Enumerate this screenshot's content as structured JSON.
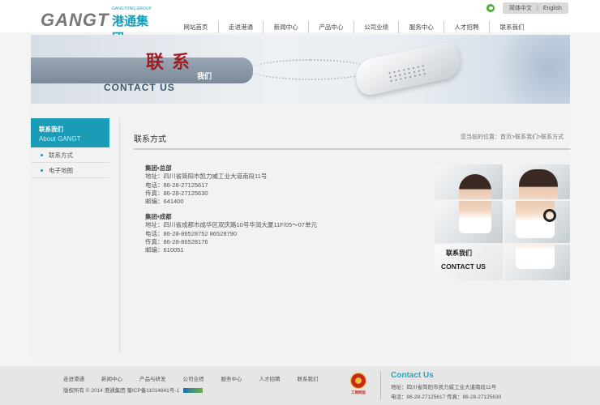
{
  "brand": {
    "logo_en": "GANGT",
    "logo_small": "GANGTONG GROUP",
    "logo_cn": "港通集团"
  },
  "lang": {
    "cn": "简体中文",
    "sep": "|",
    "en": "English"
  },
  "nav": [
    "网站首页",
    "走进港通",
    "新闻中心",
    "产品中心",
    "公司业绩",
    "服务中心",
    "人才招聘",
    "联系我们"
  ],
  "banner": {
    "title_cn": "联系",
    "sub_cn": "我们",
    "title_en": "CONTACT US"
  },
  "sidebar": {
    "heading_cn": "联系我们",
    "heading_en": "About GANGT",
    "items": [
      "联系方式",
      "电子地图"
    ]
  },
  "main": {
    "title": "联系方式",
    "breadcrumb": "您当前的位置：首页>联系我们>联系方式",
    "hq": {
      "heading": "集团•总部",
      "address": "地址：四川省简阳市凯力威工业大道南段11号",
      "phone": "电话：86-28-27125617",
      "fax": "传真：86-28-27125630",
      "zip": "邮编：641400"
    },
    "chengdu": {
      "heading": "集团•成都",
      "address": "地址：四川省成都市成华区双庆路10号华润大厦11F/05～07单元",
      "phone": "电话：86-28-86528752 86528790",
      "fax": "传真：86-28-86528176",
      "zip": "邮编：610051"
    },
    "photo": {
      "label_cn": "联系我们",
      "label_en": "CONTACT US"
    }
  },
  "footer": {
    "nav": [
      "走进港通",
      "新闻中心",
      "产品与研发",
      "公司业绩",
      "服务中心",
      "人才招聘",
      "联系我们"
    ],
    "copyright": "版权所有 © 2014 港通集团 蜀ICP备11014841号-1",
    "badge": "工商网监",
    "contact_title": "Contact Us",
    "address": "地址：四川省简阳市凯力威工业大道南段11号",
    "phone_fax": "电话：86-28-27125617  传真：86-28-27125630"
  },
  "colors": {
    "accent": "#1a9cb6",
    "banner_red": "#9e1d25"
  }
}
